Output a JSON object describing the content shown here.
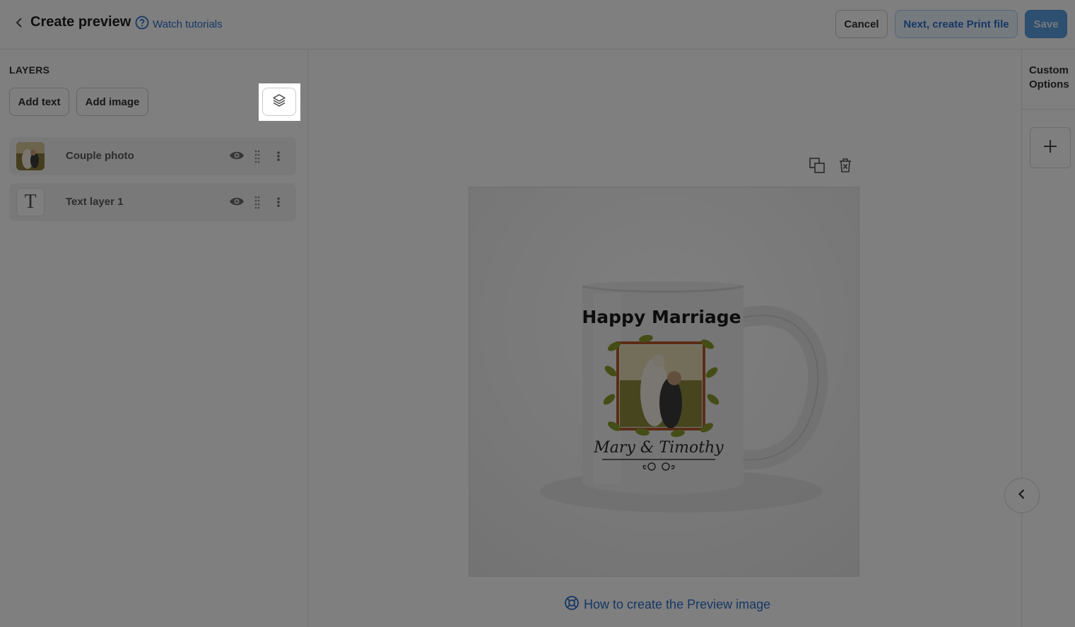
{
  "header": {
    "title": "Create preview",
    "tutorial_link": "Watch tutorials",
    "cancel_label": "Cancel",
    "next_label": "Next, create Print file",
    "save_label": "Save"
  },
  "layers_panel": {
    "title": "LAYERS",
    "add_text_label": "Add text",
    "add_image_label": "Add image",
    "layers": [
      {
        "name": "Couple photo",
        "type": "image"
      },
      {
        "name": "Text layer 1",
        "type": "text",
        "thumb_glyph": "T"
      }
    ]
  },
  "preview": {
    "mug_title": "Happy Marriage",
    "mug_names": "Mary & Timothy",
    "help_link": "How to create the Preview image"
  },
  "custom_options": {
    "title": "Custom Options",
    "add_icon": "plus-icon"
  },
  "icons": {
    "back": "chevron-left-icon",
    "help": "question-circle-icon",
    "layers": "layers-stack-icon",
    "visibility": "eye-icon",
    "drag": "drag-handle-icon",
    "more": "more-vertical-icon",
    "duplicate": "duplicate-icon",
    "delete": "trash-x-icon",
    "lifebuoy": "lifebuoy-icon",
    "collapse": "chevron-left-icon"
  },
  "colors": {
    "link_blue": "#2c6ecb",
    "save_blue": "#5a9fe0",
    "overlay": "rgba(0,0,0,0.5)"
  }
}
